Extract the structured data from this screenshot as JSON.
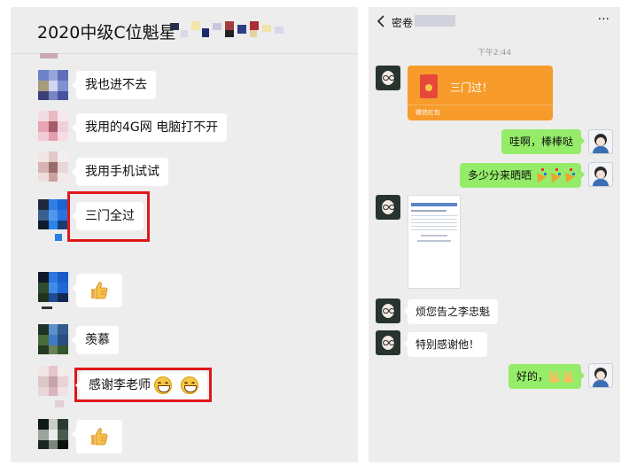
{
  "group_chat": {
    "title": "2020中级C位魁星",
    "messages": [
      {
        "text": "我也进不去"
      },
      {
        "text": "我用的4G网 电脑打不开"
      },
      {
        "text": "我用手机试试"
      },
      {
        "text": "三门全过"
      },
      {
        "text": "",
        "icon": "thumbs-up-icon"
      },
      {
        "text": "羡慕"
      },
      {
        "text": "感谢李老师"
      },
      {
        "text": "",
        "icon": "thumbs-up-icon"
      }
    ]
  },
  "private_chat": {
    "title": "密卷",
    "more": "···",
    "time": "下午2:44",
    "red_packet": {
      "text": "三门过！",
      "footer": "微信红包"
    },
    "messages": [
      {
        "text": "哇啊，棒棒哒"
      },
      {
        "text": "多少分来晒晒"
      },
      {
        "text": "烦您告之李忠魁"
      },
      {
        "text": "特别感谢他！"
      },
      {
        "text": "好的，"
      }
    ]
  },
  "colors": {
    "highlight": "#e0161b",
    "self_bubble": "#95ec69",
    "red_packet": "#f79c2a"
  }
}
